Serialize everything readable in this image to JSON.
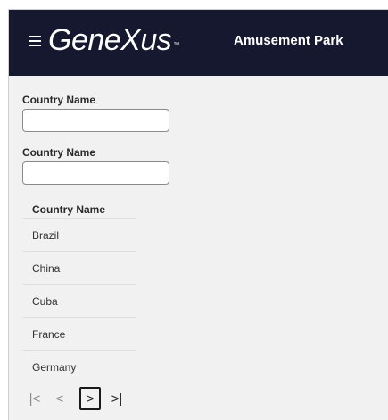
{
  "header": {
    "logo_text": "GeneXus",
    "logo_tm": "™",
    "title": "Amusement Park"
  },
  "filters": [
    {
      "label": "Country Name",
      "value": "",
      "placeholder": ""
    },
    {
      "label": "Country Name",
      "value": "",
      "placeholder": ""
    }
  ],
  "grid": {
    "column_header": "Country Name",
    "rows": [
      "Brazil",
      "China",
      "Cuba",
      "France",
      "Germany"
    ]
  },
  "pager": {
    "first": "|<",
    "prev": "<",
    "next": ">",
    "last": ">|"
  },
  "colors": {
    "header_bg": "#15182f",
    "page_bg": "#f1f1f1"
  }
}
